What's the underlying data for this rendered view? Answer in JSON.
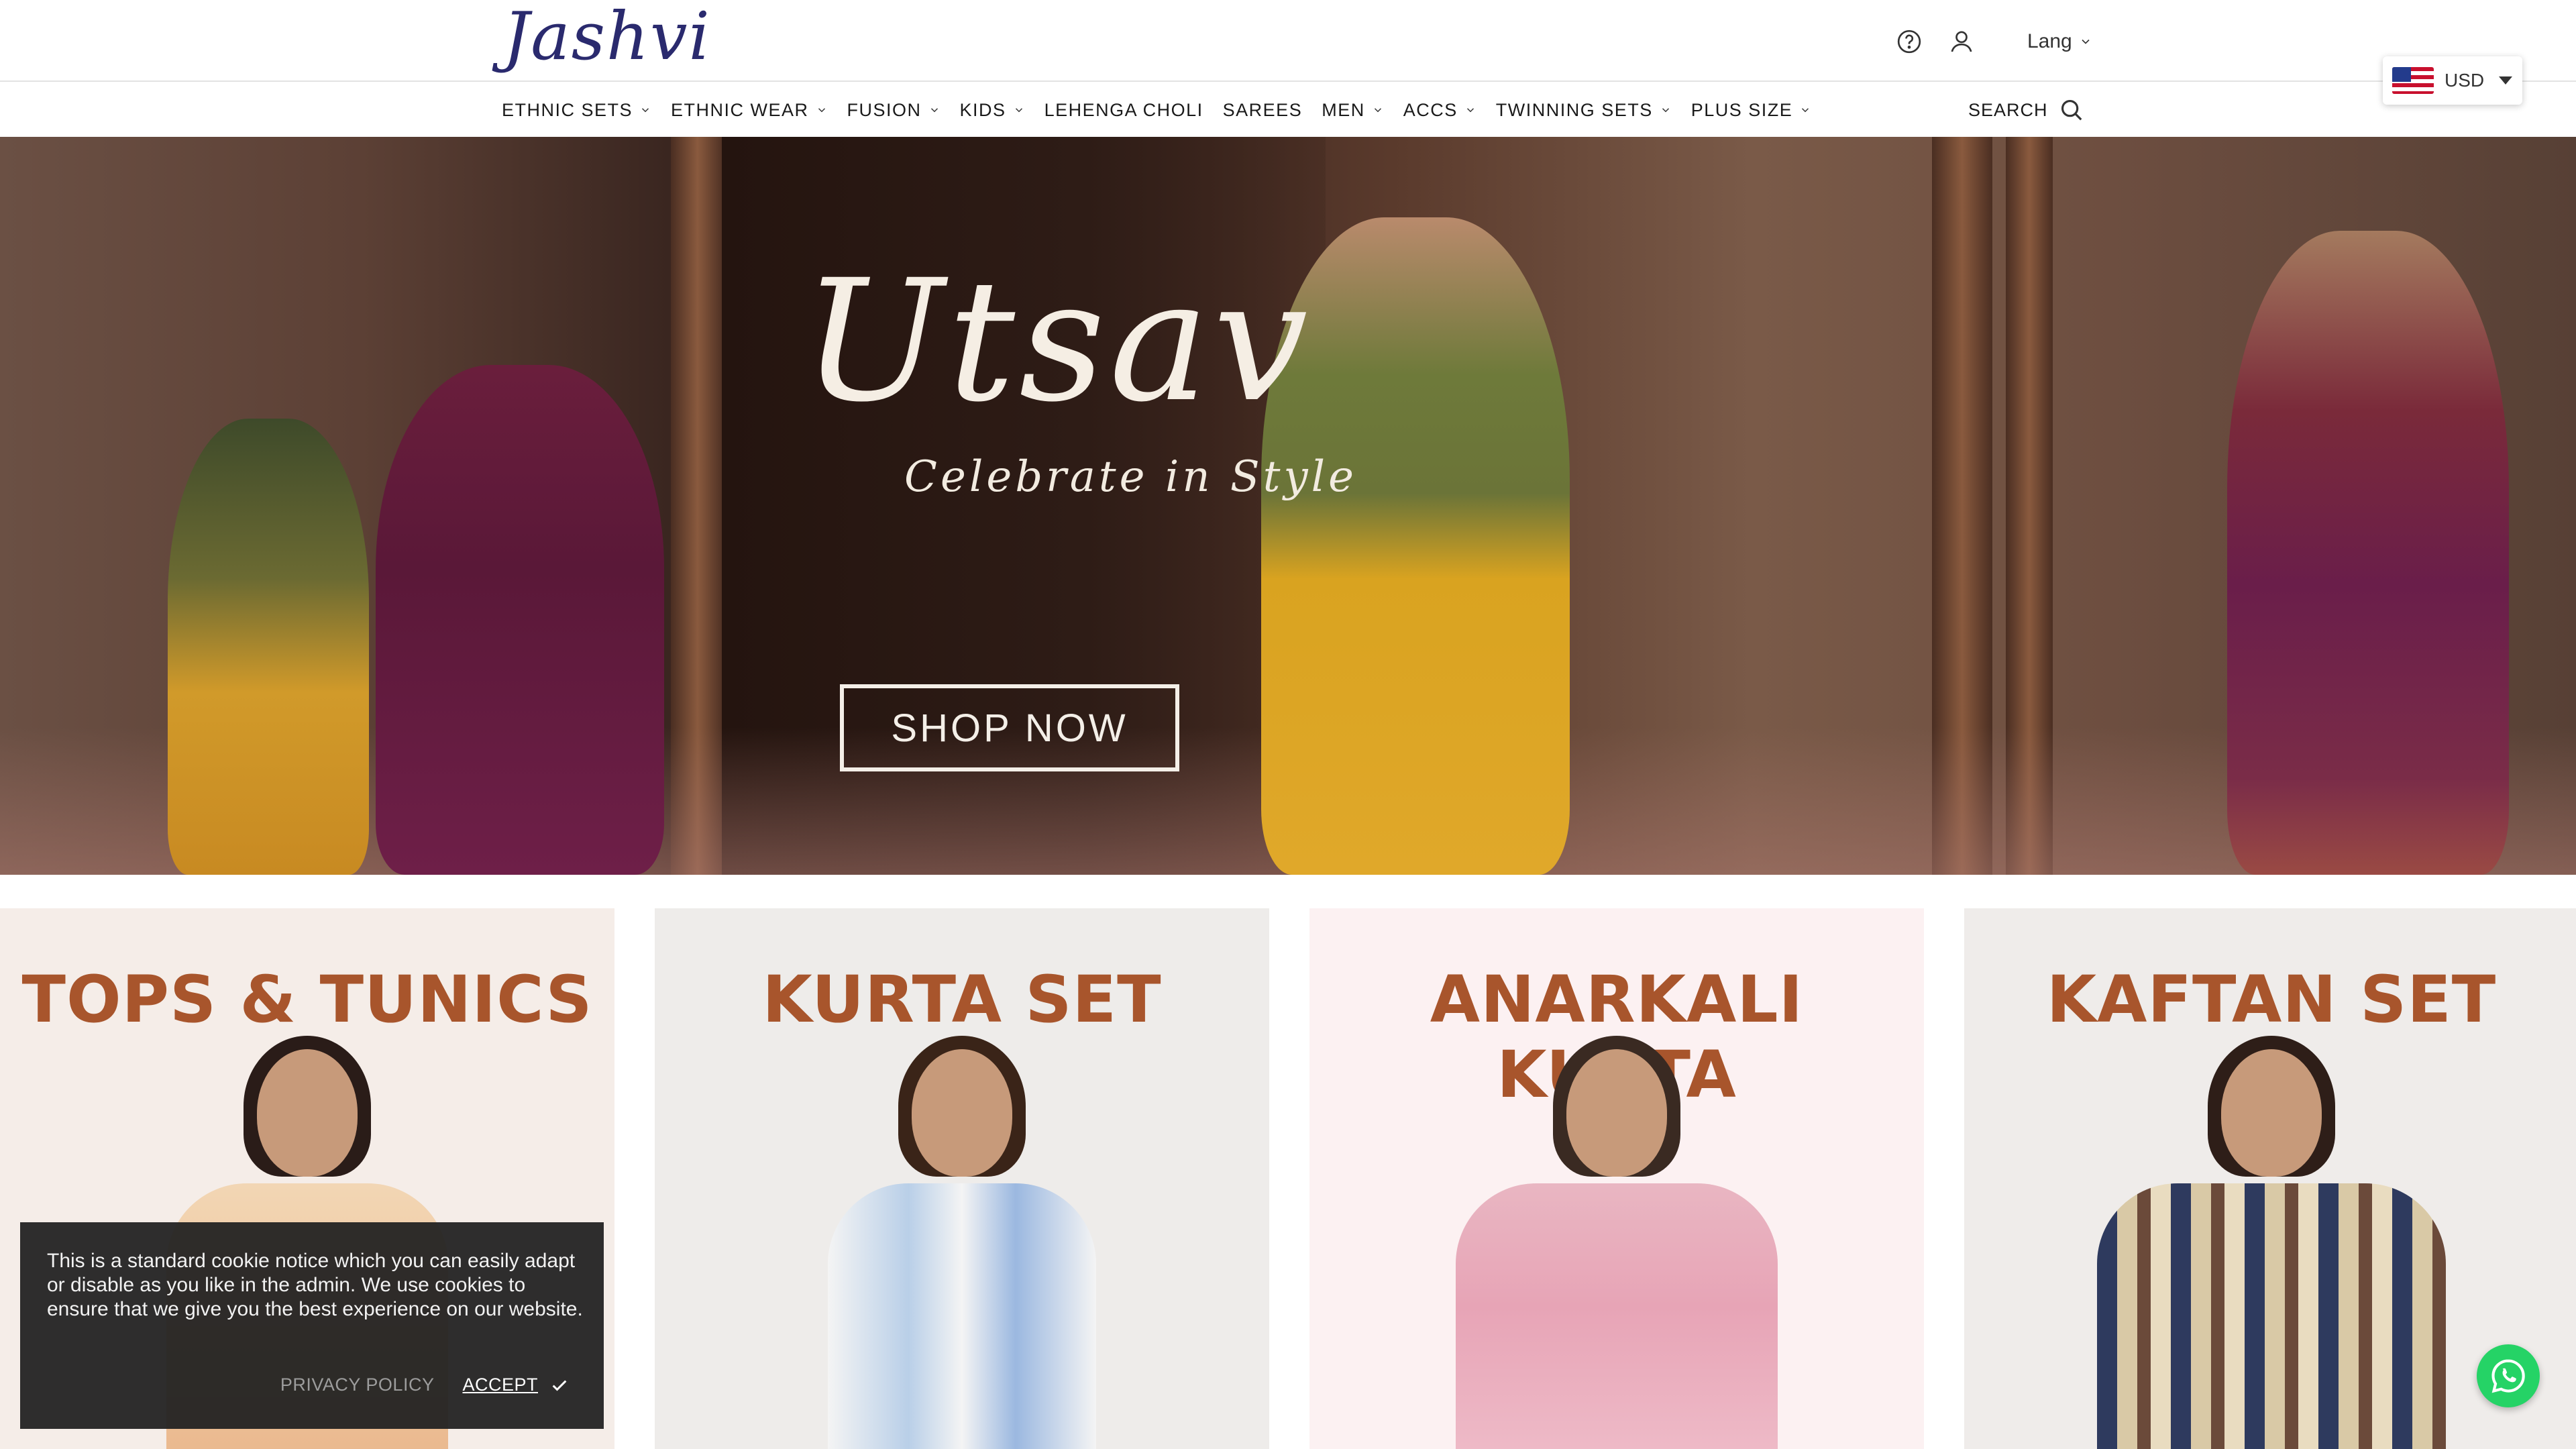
{
  "brand": {
    "logo_text": "Jashvi"
  },
  "header": {
    "lang_label": "Lang",
    "currency": {
      "code": "USD",
      "flag": "us-flag"
    }
  },
  "nav": {
    "items": [
      {
        "label": "ETHNIC SETS",
        "has_dropdown": true
      },
      {
        "label": "ETHNIC WEAR",
        "has_dropdown": true
      },
      {
        "label": "FUSION",
        "has_dropdown": true
      },
      {
        "label": "KIDS",
        "has_dropdown": true
      },
      {
        "label": "LEHENGA CHOLI",
        "has_dropdown": false
      },
      {
        "label": "SAREES",
        "has_dropdown": false
      },
      {
        "label": "MEN",
        "has_dropdown": true
      },
      {
        "label": "ACCS",
        "has_dropdown": true
      },
      {
        "label": "TWINNING SETS",
        "has_dropdown": true
      },
      {
        "label": "PLUS SIZE",
        "has_dropdown": true
      }
    ],
    "search_label": "SEARCH"
  },
  "hero": {
    "title": "Utsav",
    "subtitle": "Celebrate in Style",
    "cta_label": "SHOP NOW"
  },
  "categories": [
    {
      "title": "TOPS & TUNICS",
      "bg": "#f5ede8"
    },
    {
      "title": "KURTA SET",
      "bg": "#eeecea"
    },
    {
      "title": "ANARKALI KURTA",
      "bg": "#fcf1f2"
    },
    {
      "title": "KAFTAN SET",
      "bg": "#efecea"
    }
  ],
  "cookie": {
    "message": "This is a standard cookie notice which you can easily adapt or disable as you like in the admin. We use cookies to ensure that we give you the best experience on our website.",
    "privacy_label": "PRIVACY POLICY",
    "accept_label": "ACCEPT"
  },
  "colors": {
    "brand": "#2a2a6e",
    "category_title": "#a8552c",
    "whatsapp": "#25d366"
  }
}
